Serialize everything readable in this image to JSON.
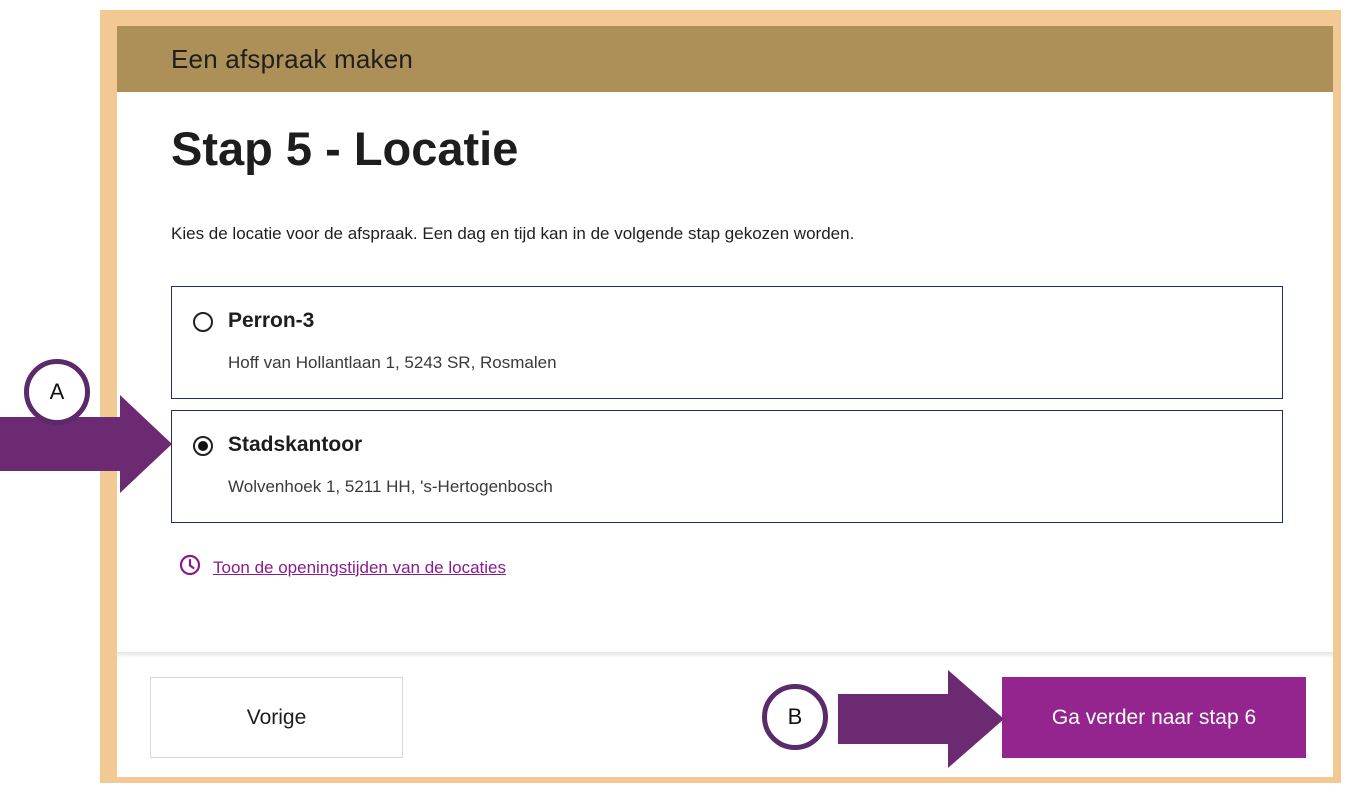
{
  "header": {
    "title": "Een afspraak maken"
  },
  "page": {
    "title": "Stap 5 - Locatie",
    "intro": "Kies de locatie voor de afspraak. Een dag en tijd kan in de volgende stap gekozen worden."
  },
  "locations": [
    {
      "name": "Perron-3",
      "address": "Hoff van Hollantlaan 1, 5243 SR, Rosmalen",
      "selected": false
    },
    {
      "name": "Stadskantoor",
      "address": "Wolvenhoek 1, 5211 HH, 's-Hertogenbosch",
      "selected": true
    }
  ],
  "hours_link": {
    "label": "Toon de openingstijden van de locaties",
    "icon": "clock-icon"
  },
  "footer": {
    "prev_label": "Vorige",
    "next_label": "Ga verder naar stap 6"
  },
  "annotations": {
    "marker_a": "A",
    "marker_b": "B"
  },
  "colors": {
    "header_bg": "#ad8f58",
    "frame": "#f2c893",
    "accent": "#94258f",
    "arrow": "#6b2a72"
  }
}
